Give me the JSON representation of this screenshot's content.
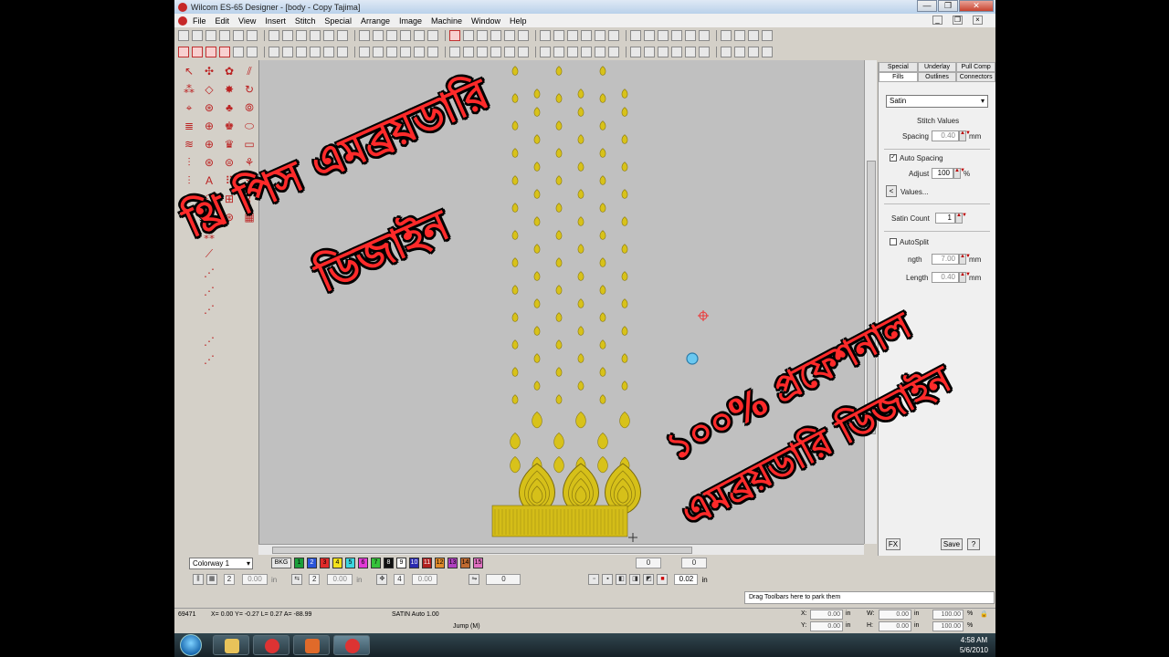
{
  "window": {
    "title": "Wilcom ES-65 Designer - [body - Copy        Tajima]",
    "controls": [
      "—",
      "❐",
      "✕"
    ]
  },
  "menu": {
    "items": [
      "File",
      "Edit",
      "View",
      "Insert",
      "Stitch",
      "Special",
      "Arrange",
      "Image",
      "Machine",
      "Window",
      "Help"
    ]
  },
  "right_panel": {
    "tabs_row1": [
      "Special",
      "Underlay",
      "Pull Comp"
    ],
    "tabs_row2": [
      "Fills",
      "Outlines",
      "Connectors"
    ],
    "fill_type": "Satin",
    "stitch_values_label": "Stitch Values",
    "spacing_label": "Spacing",
    "spacing_value": "0.40",
    "spacing_unit": "mm",
    "auto_spacing_label": "Auto Spacing",
    "auto_spacing_checked": true,
    "adjust_label": "Adjust",
    "adjust_value": "100",
    "adjust_unit": "%",
    "values_button": "Values...",
    "values_arrow": "<",
    "satin_count_label": "Satin Count",
    "satin_count_value": "1",
    "autosplit_label": "AutoSplit",
    "length_label": "ngth",
    "length_value": "7.00",
    "min_length_label": "Length",
    "min_length_value": "0.40",
    "unit_mm": "mm",
    "fx_button": "FX",
    "save_button": "Save",
    "help_button": "?"
  },
  "colorbar": {
    "colorway": "Colorway 1",
    "bkg": "BKG",
    "swatches": [
      {
        "n": "1",
        "color": "#1a9e3a"
      },
      {
        "n": "2",
        "color": "#2b55d8"
      },
      {
        "n": "3",
        "color": "#e02a2a"
      },
      {
        "n": "4",
        "color": "#f4e21a"
      },
      {
        "n": "5",
        "color": "#3cd6e0"
      },
      {
        "n": "6",
        "color": "#e23ad6"
      },
      {
        "n": "7",
        "color": "#35c23a"
      },
      {
        "n": "8",
        "color": "#111111"
      },
      {
        "n": "9",
        "color": "#ffffff"
      },
      {
        "n": "10",
        "color": "#2a2ab0"
      },
      {
        "n": "11",
        "color": "#b02020"
      },
      {
        "n": "12",
        "color": "#e08a2a"
      },
      {
        "n": "13",
        "color": "#b040c0"
      },
      {
        "n": "14",
        "color": "#c06a30"
      },
      {
        "n": "15",
        "color": "#e070c0"
      }
    ],
    "field_1": "0",
    "field_2": "0"
  },
  "statusrow": {
    "v1": "2",
    "f1": "0.00",
    "u1": "in",
    "v2": "2",
    "f2": "0.00",
    "u2": "in",
    "v3": "4",
    "f3": "0.00",
    "f4": "0",
    "zoom_value": "0.02",
    "zoom_unit": "in"
  },
  "drag_toolbar_hint": "Drag Toolbars here to park them",
  "statusbar": {
    "stitch_count": "69471",
    "coords": "X=  0.00 Y= -0.27 L=  0.27 A= -88.99",
    "stitch_type": "SATIN Auto  1.00",
    "jump": "Jump (M)",
    "x_label": "X:",
    "x_value": "0.00",
    "x_unit": "in",
    "y_label": "Y:",
    "y_value": "0.00",
    "y_unit": "in",
    "w_label": "W:",
    "w_value": "0.00",
    "w_unit": "in",
    "h_label": "H:",
    "h_value": "0.00",
    "h_unit": "in",
    "pct1": "100.00",
    "pct2": "100.00",
    "pct_unit": "%"
  },
  "taskbar": {
    "time": "4:58 AM",
    "date": "5/6/2010"
  },
  "overlay": {
    "left_line1": "থ্রি পিস এমব্রয়ডারি",
    "left_line2": "ডিজাইন",
    "right_line1": "১০০% প্রফেশনাল",
    "right_line2": "এমব্রয়ডারি ডিজাইন"
  }
}
